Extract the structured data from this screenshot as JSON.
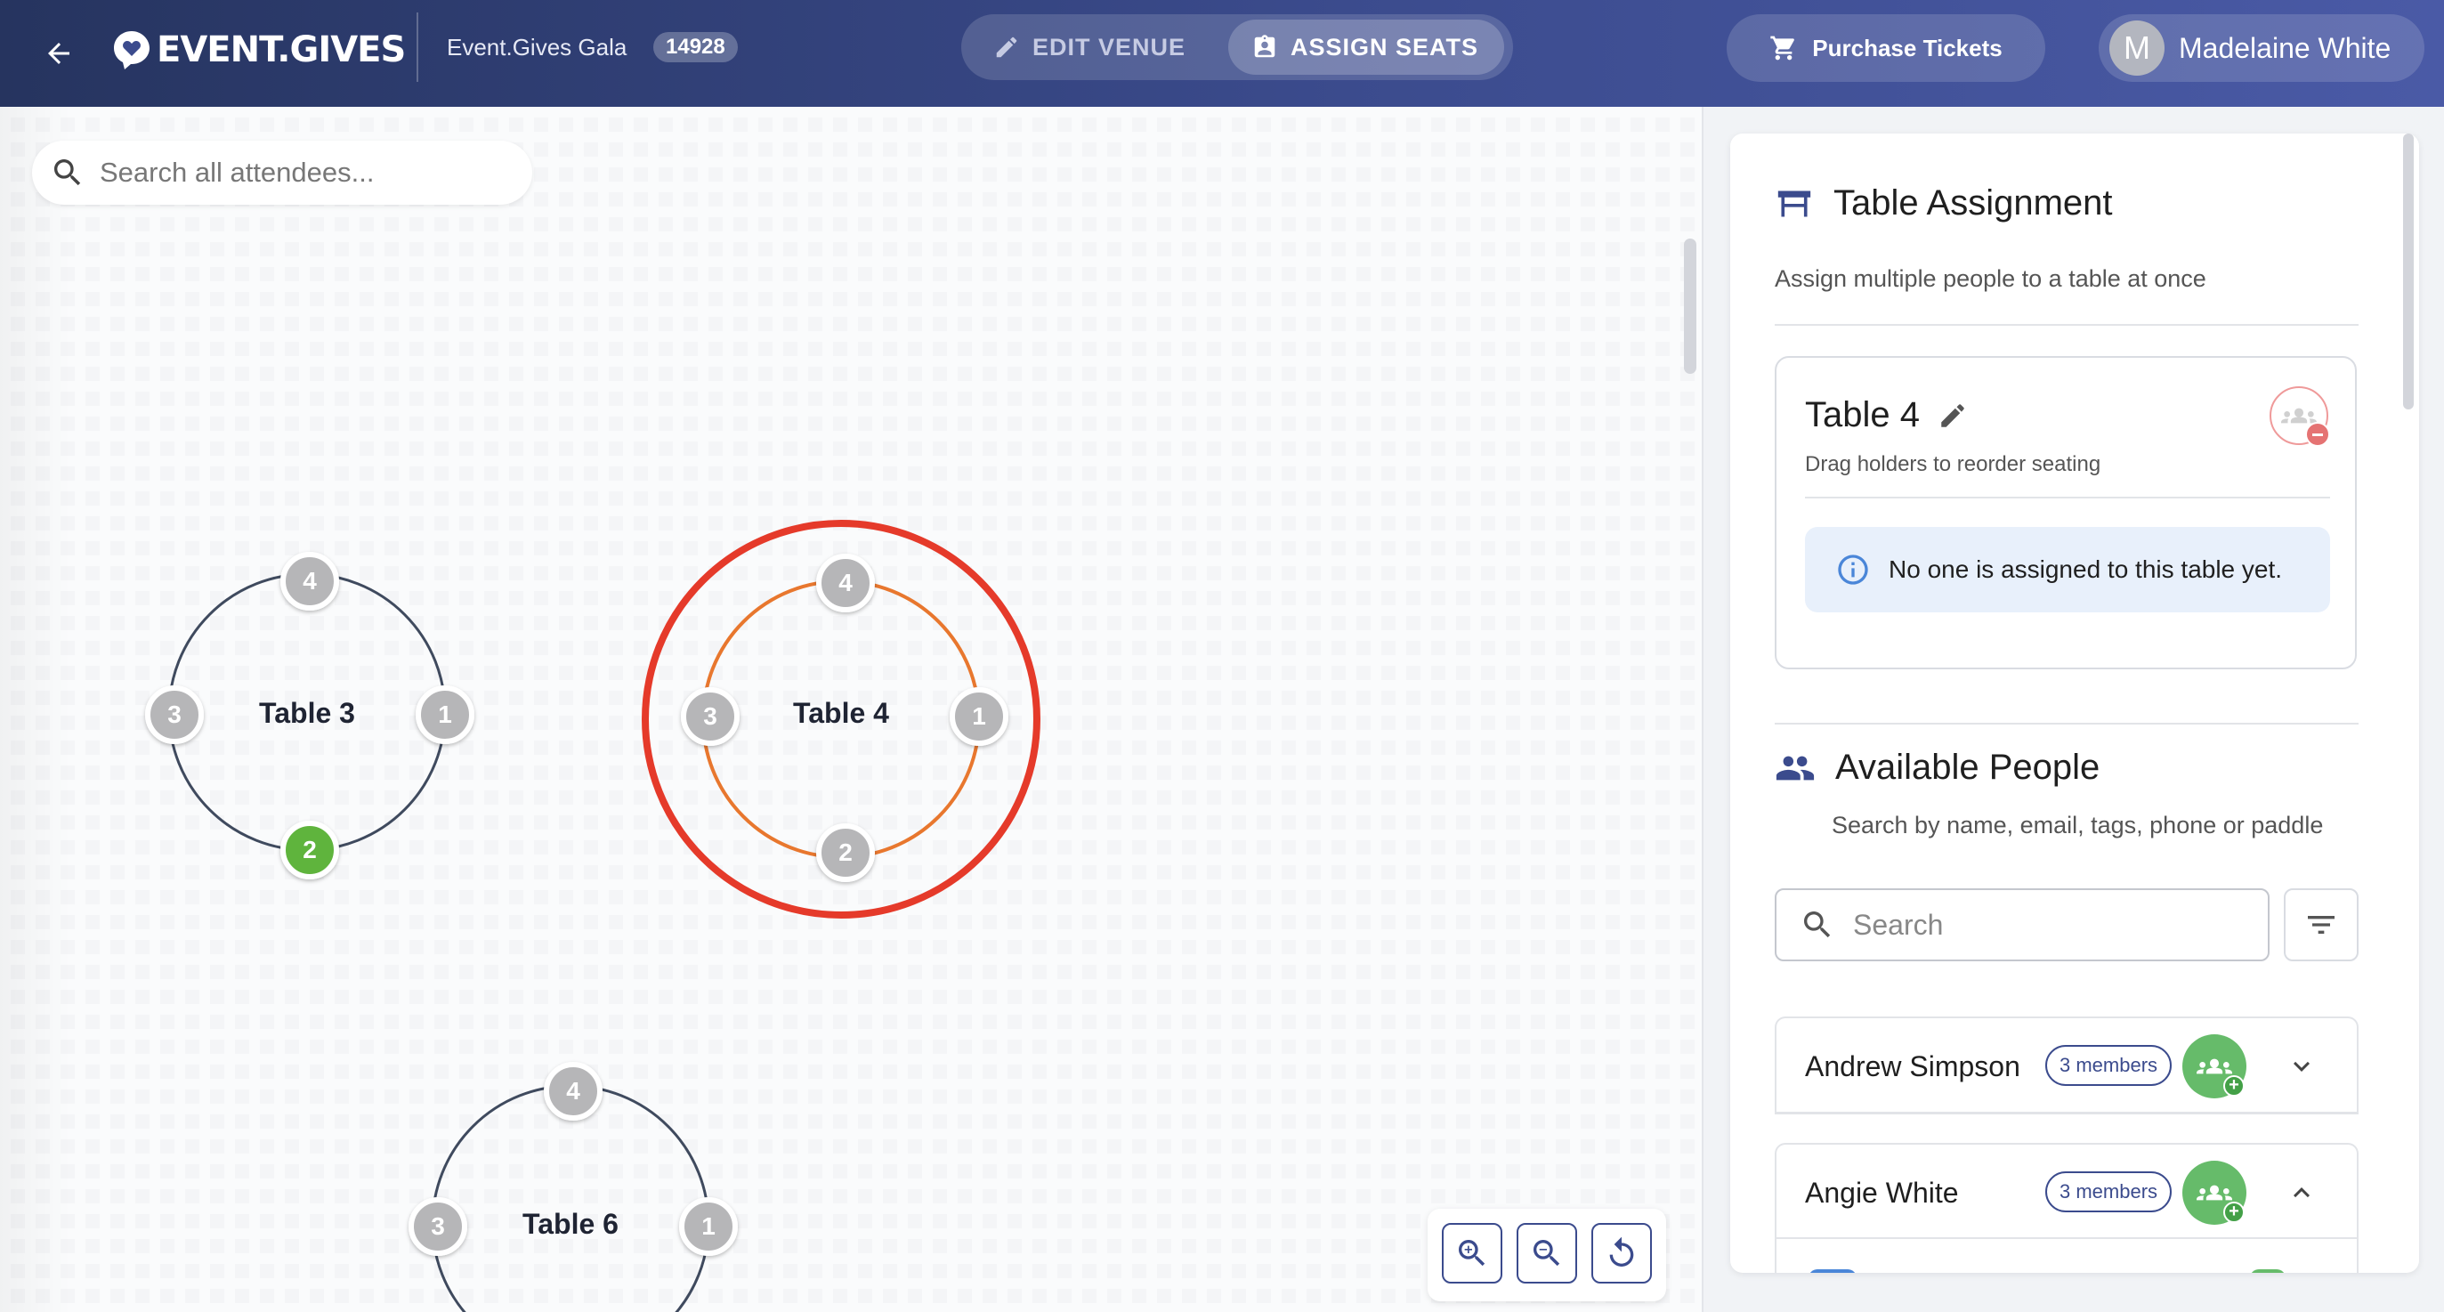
{
  "header": {
    "logo_text": "EVENT.GIVES",
    "event_name": "Event.Gives Gala",
    "event_id": "14928",
    "edit_venue_label": "EDIT VENUE",
    "assign_seats_label": "ASSIGN SEATS",
    "purchase_label": "Purchase Tickets",
    "user_initial": "M",
    "user_name": "Madelaine White"
  },
  "canvas": {
    "search_placeholder": "Search all attendees...",
    "tables": [
      {
        "label": "Table 3",
        "selected": false,
        "seats": [
          "4",
          "1",
          "2",
          "3"
        ],
        "occupied_seat": "2"
      },
      {
        "label": "Table 4",
        "selected": true,
        "seats": [
          "4",
          "1",
          "2",
          "3"
        ],
        "occupied_seat": null
      },
      {
        "label": "Table 6",
        "selected": false,
        "seats": [
          "4",
          "1",
          "3"
        ],
        "occupied_seat": null
      }
    ],
    "zoom_controls": [
      "zoom-in-icon",
      "zoom-out-icon",
      "reset-view-icon"
    ]
  },
  "panel": {
    "assignment_title": "Table Assignment",
    "assignment_subtitle": "Assign multiple people to a table at once",
    "selected_table": {
      "title": "Table 4",
      "subtitle": "Drag holders to reorder seating",
      "empty_message": "No one is assigned to this table yet."
    },
    "people_title": "Available People",
    "people_subtitle": "Search by name, email, tags, phone or paddle",
    "search_placeholder": "Search",
    "people": [
      {
        "name": "Andrew Simpson",
        "members": "3 members",
        "expanded": false
      },
      {
        "name": "Angie White",
        "members": "3 members",
        "expanded": true
      }
    ]
  },
  "colors": {
    "header_start": "#26345f",
    "header_end": "#4a5aa6",
    "selected_ring": "#e53a2a",
    "selected_table_outline": "#e8772e",
    "occupied_seat": "#66bb6a",
    "accent": "#3b4b8d"
  }
}
